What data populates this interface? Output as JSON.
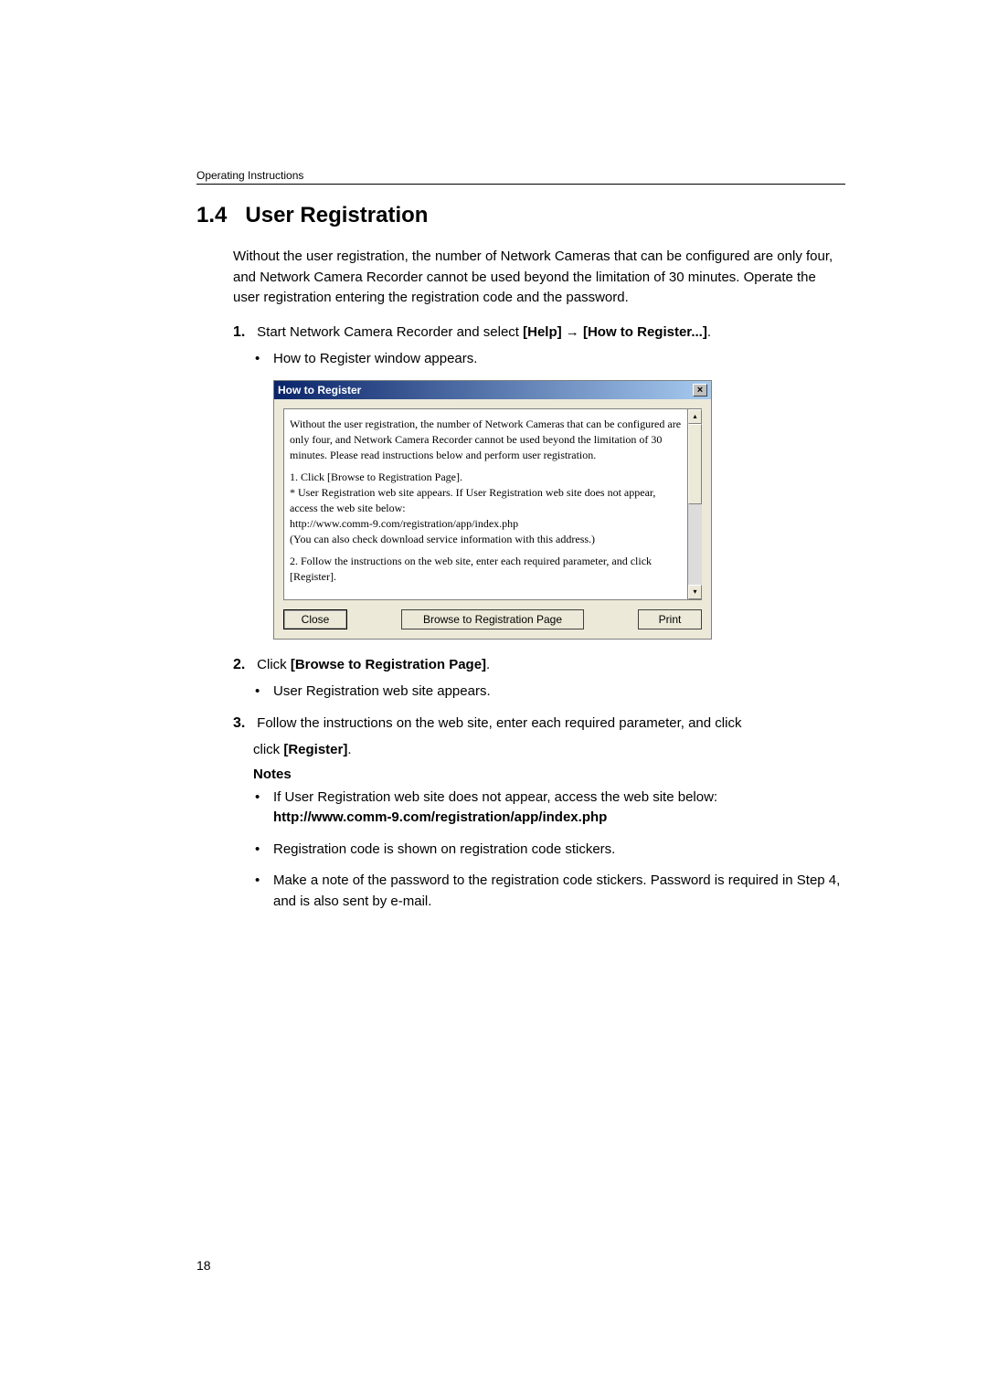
{
  "header": "Operating Instructions",
  "section": {
    "number": "1.4",
    "title": "User Registration"
  },
  "intro": "Without the user registration, the number of Network Cameras that can be configured are only four, and Network Camera Recorder cannot be used beyond the limitation of 30 minutes. Operate the user registration entering the registration code and the password.",
  "step1": {
    "num": "1.",
    "text_a": "Start Network Camera Recorder and select ",
    "bold_a": "[Help]",
    "arrow": " → ",
    "bold_b": "[How to Register...]",
    "tail": ".",
    "bullet": "How to Register window appears."
  },
  "dialog": {
    "title": "How to Register",
    "close": "×",
    "para1": "Without the user registration, the number of Network Cameras that can be configured are only four, and Network Camera Recorder cannot be used beyond the limitation of 30 minutes. Please read instructions below and perform user registration.",
    "para2": "1. Click [Browse to Registration Page].\n* User Registration web site appears. If User Registration web site does not appear, access the web site below:\nhttp://www.comm-9.com/registration/app/index.php\n(You can also check download service information with this address.)",
    "para3": "2. Follow the instructions on the web site, enter each required parameter, and click [Register].",
    "btn_close": "Close",
    "btn_browse": "Browse to Registration Page",
    "btn_print": "Print",
    "scroll_up": "▴",
    "scroll_down": "▾"
  },
  "step2": {
    "num": "2.",
    "text_a": "Click ",
    "bold_a": "[Browse to Registration Page]",
    "tail": ".",
    "bullet": "User Registration web site appears."
  },
  "step3": {
    "num": "3.",
    "text_a": "Follow the instructions on the web site, enter each required parameter, and click ",
    "bold_a": "[Register]",
    "tail": ".",
    "notes": "Notes",
    "bullet1_a": "If User Registration web site does not appear, access the web site below: ",
    "bullet1_b": "http://www.comm-9.com/registration/app/index.php",
    "bullet2": "Registration code is shown on registration code stickers.",
    "bullet3": "Make a note of the password to the registration code stickers. Password is required in Step 4, and is also sent by e-mail."
  },
  "pageNumber": "18"
}
